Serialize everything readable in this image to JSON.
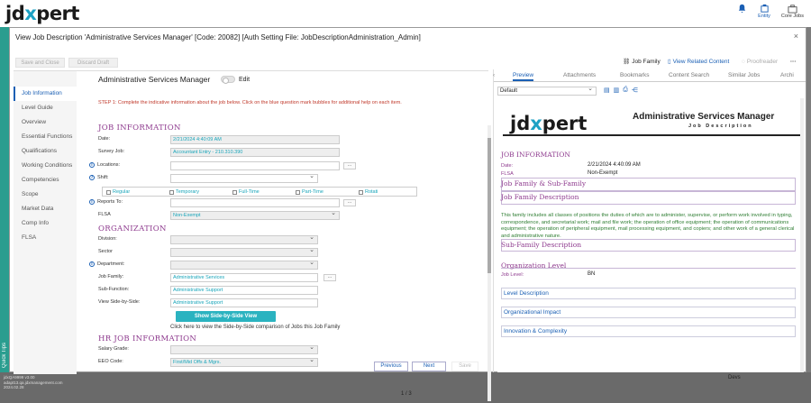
{
  "app": {
    "logo": "jdxpert",
    "top_right": {
      "entity_label": "Entity",
      "core_jobs_label": "Core Jobs"
    },
    "side_tab_label": "Quick Tips",
    "status_lines": [
      "jdxQA9999 v3.00",
      "adapt13.qa.jdxmanagement.com",
      "2024.02.28"
    ],
    "pager": "1 / 3",
    "devs_label": "Devs"
  },
  "modal": {
    "title": "View Job Description 'Administrative Services Manager'  [Code: 20082] [Auth Setting File: JobDescriptionAdministration_Admin]",
    "close_glyph": "×",
    "toolbar": {
      "save_and_close": "Save and Close",
      "discard_draft": "Discard Draft",
      "job_family": "Job Family",
      "view_related_content": "View Related Content",
      "proofreader": "Proofreader",
      "more": "···"
    }
  },
  "sidebar": {
    "items": [
      {
        "label": "Job Information",
        "active": true
      },
      {
        "label": "Level Guide"
      },
      {
        "label": "Overview"
      },
      {
        "label": "Essential Functions"
      },
      {
        "label": "Qualifications"
      },
      {
        "label": "Working Conditions"
      },
      {
        "label": "Competencies"
      },
      {
        "label": "Scope"
      },
      {
        "label": "Market Data"
      },
      {
        "label": "Comp Info"
      },
      {
        "label": "FLSA"
      }
    ]
  },
  "form": {
    "job_name": "Administrative Services Manager",
    "edit_label": "Edit",
    "step_text": "STEP 1:  Complete the indicative information about the job below.  Click on the blue question mark bubbles for additional help on each item.",
    "job_info_heading": "JOB INFORMATION",
    "date_label": "Date:",
    "date_value": "2/21/2024 4:40:09 AM",
    "survey_job_label": "Survey Job:",
    "survey_job_value": "Accountant Entry - 210.310.390",
    "locations_label": "Locations:",
    "shift_label": "Shift:",
    "shift_options": [
      "Regular",
      "Temporary",
      "Full-Time",
      "Part-Time",
      "Rotati"
    ],
    "reports_to_label": "Reports To:",
    "flsa_label": "FLSA",
    "flsa_value": "Non-Exempt",
    "org_heading": "ORGANIZATION",
    "division_label": "Division:",
    "sector_label": "Sector",
    "department_label": "Department:",
    "job_family_label": "Job Family:",
    "job_family_value": "Administrative Services",
    "sub_function_label": "Sub-Function:",
    "sub_function_value": "Administrative Support",
    "sbs_label": "View Side-by-Side:",
    "sbs_value": "Administrative Support",
    "sbs_button": "Show Side-by-Side View",
    "sbs_note": "Click here to view the Side-by-Side comparison of Jobs this Job Family",
    "hr_heading": "HR JOB INFORMATION",
    "salary_grade_label": "Salary Grade:",
    "eeo_label": "EEO Code:",
    "eeo_value": "First/Mid Offs & Mgrs.",
    "previous": "Previous",
    "next": "Next",
    "save": "Save"
  },
  "preview": {
    "tabs": [
      "Preview",
      "Attachments",
      "Bookmarks",
      "Content Search",
      "Similar Jobs",
      "Archi"
    ],
    "template": "Default",
    "logo": "jdxpert",
    "title": "Administrative Services Manager",
    "subtitle": "Job Description",
    "job_info_heading": "JOB INFORMATION",
    "date_label": "Date:",
    "date_value": "2/21/2024 4:40:09 AM",
    "flsa_label": "FLSA",
    "flsa_value": "Non-Exempt",
    "jf_heading": "Job Family & Sub-Family",
    "jfd_heading": "Job Family Description",
    "jfd_text": "This family includes all classes of positions the duties of which are to administer, supervise, or perform work involved in typing, correspondence, and secretarial work; mail and file work; the operation of office equipment; the operation of communications equipment; the operation of peripheral equipment, mail processing equipment, and copiers; and other work of a general clerical and administrative nature.",
    "sfd_heading": "Sub-Family  Description",
    "org_level_heading": "Organization Level",
    "job_level_label": "Job Level:",
    "job_level_value": "BN",
    "rows": [
      "Level Description",
      "Organizational Impact",
      "Innovation & Complexity"
    ]
  }
}
